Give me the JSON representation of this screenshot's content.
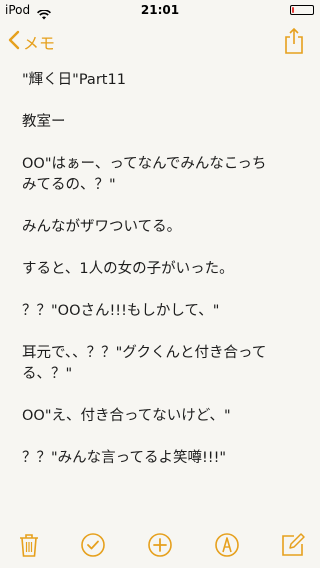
{
  "status_bar": {
    "carrier": "iPod",
    "time": "21:01",
    "battery_level": 0.12,
    "battery_color": "#e53935"
  },
  "nav": {
    "back_label": "メモ",
    "back_icon": "chevron-left-icon",
    "share_icon": "share-icon",
    "accent_color": "#e6a01d"
  },
  "note": {
    "paragraphs": [
      "\"輝く日\"Part11",
      "教室ー",
      "OO\"はぁー、ってなんでみんなこっち\nみてるの、？\"",
      "みんながザワついてる。",
      "すると、1人の女の子がいった。",
      "？？\"OOさん!!!もしかして、\"",
      "耳元で、、？？\"グクくんと付き合って\nる、？\"",
      "OO\"え、付き合ってないけど、\"",
      "？？\"みんな言ってるよ笑噂!!!\""
    ]
  },
  "toolbar": {
    "icons": [
      "trash-icon",
      "checklist-icon",
      "add-icon",
      "markup-icon",
      "compose-icon"
    ]
  }
}
